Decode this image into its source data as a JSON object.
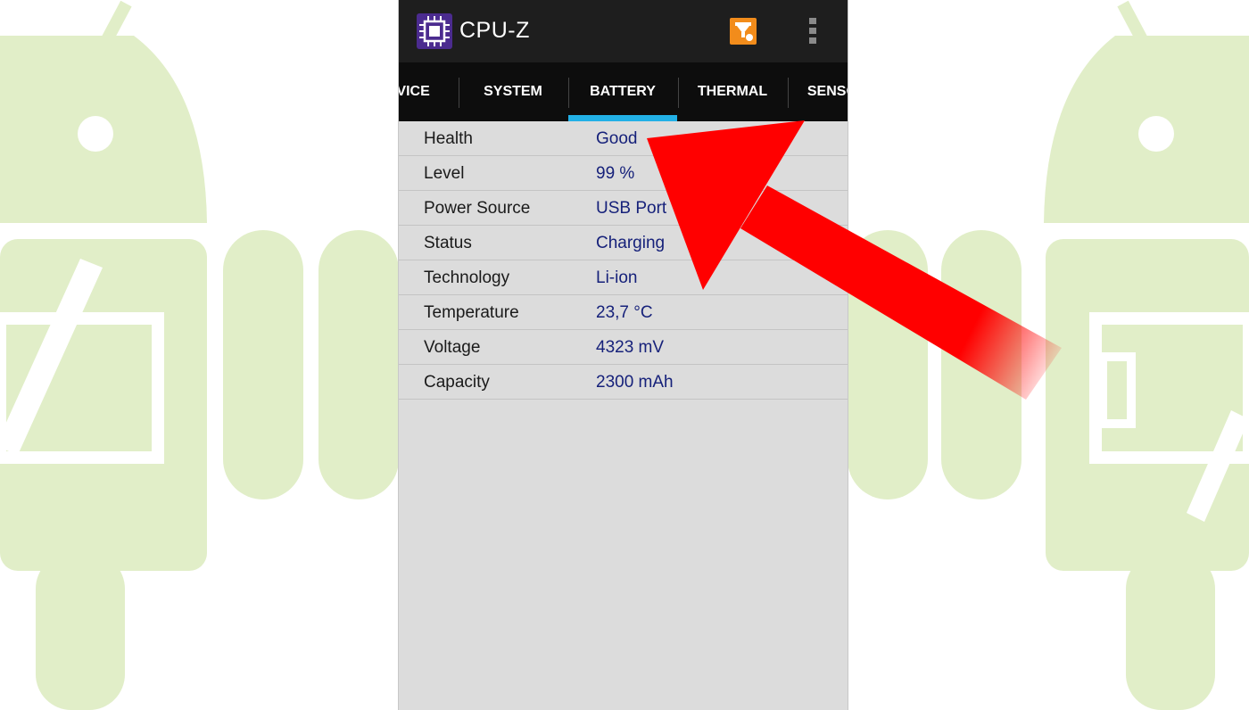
{
  "app": {
    "title": "CPU-Z",
    "icon": "cpu-chip-icon",
    "actions": [
      {
        "name": "validate-icon"
      },
      {
        "name": "overflow-menu-icon"
      }
    ]
  },
  "tabs": [
    {
      "label": "DEVICE",
      "active": false
    },
    {
      "label": "SYSTEM",
      "active": false
    },
    {
      "label": "BATTERY",
      "active": true
    },
    {
      "label": "THERMAL",
      "active": false
    },
    {
      "label": "SENSORS",
      "active": false
    }
  ],
  "battery": [
    {
      "label": "Health",
      "value": "Good"
    },
    {
      "label": "Level",
      "value": "99 %"
    },
    {
      "label": "Power Source",
      "value": "USB Port"
    },
    {
      "label": "Status",
      "value": "Charging"
    },
    {
      "label": "Technology",
      "value": "Li-ion"
    },
    {
      "label": "Temperature",
      "value": "23,7 °C"
    },
    {
      "label": "Voltage",
      "value": "4323 mV"
    },
    {
      "label": "Capacity",
      "value": "2300 mAh"
    }
  ],
  "colors": {
    "appbar": "#1e1e1e",
    "tabbar": "#0d0d0d",
    "tab_indicator": "#22b0e6",
    "value_text": "#16217a",
    "android_bg": "#e1eec8",
    "arrow": "#ff0000"
  }
}
